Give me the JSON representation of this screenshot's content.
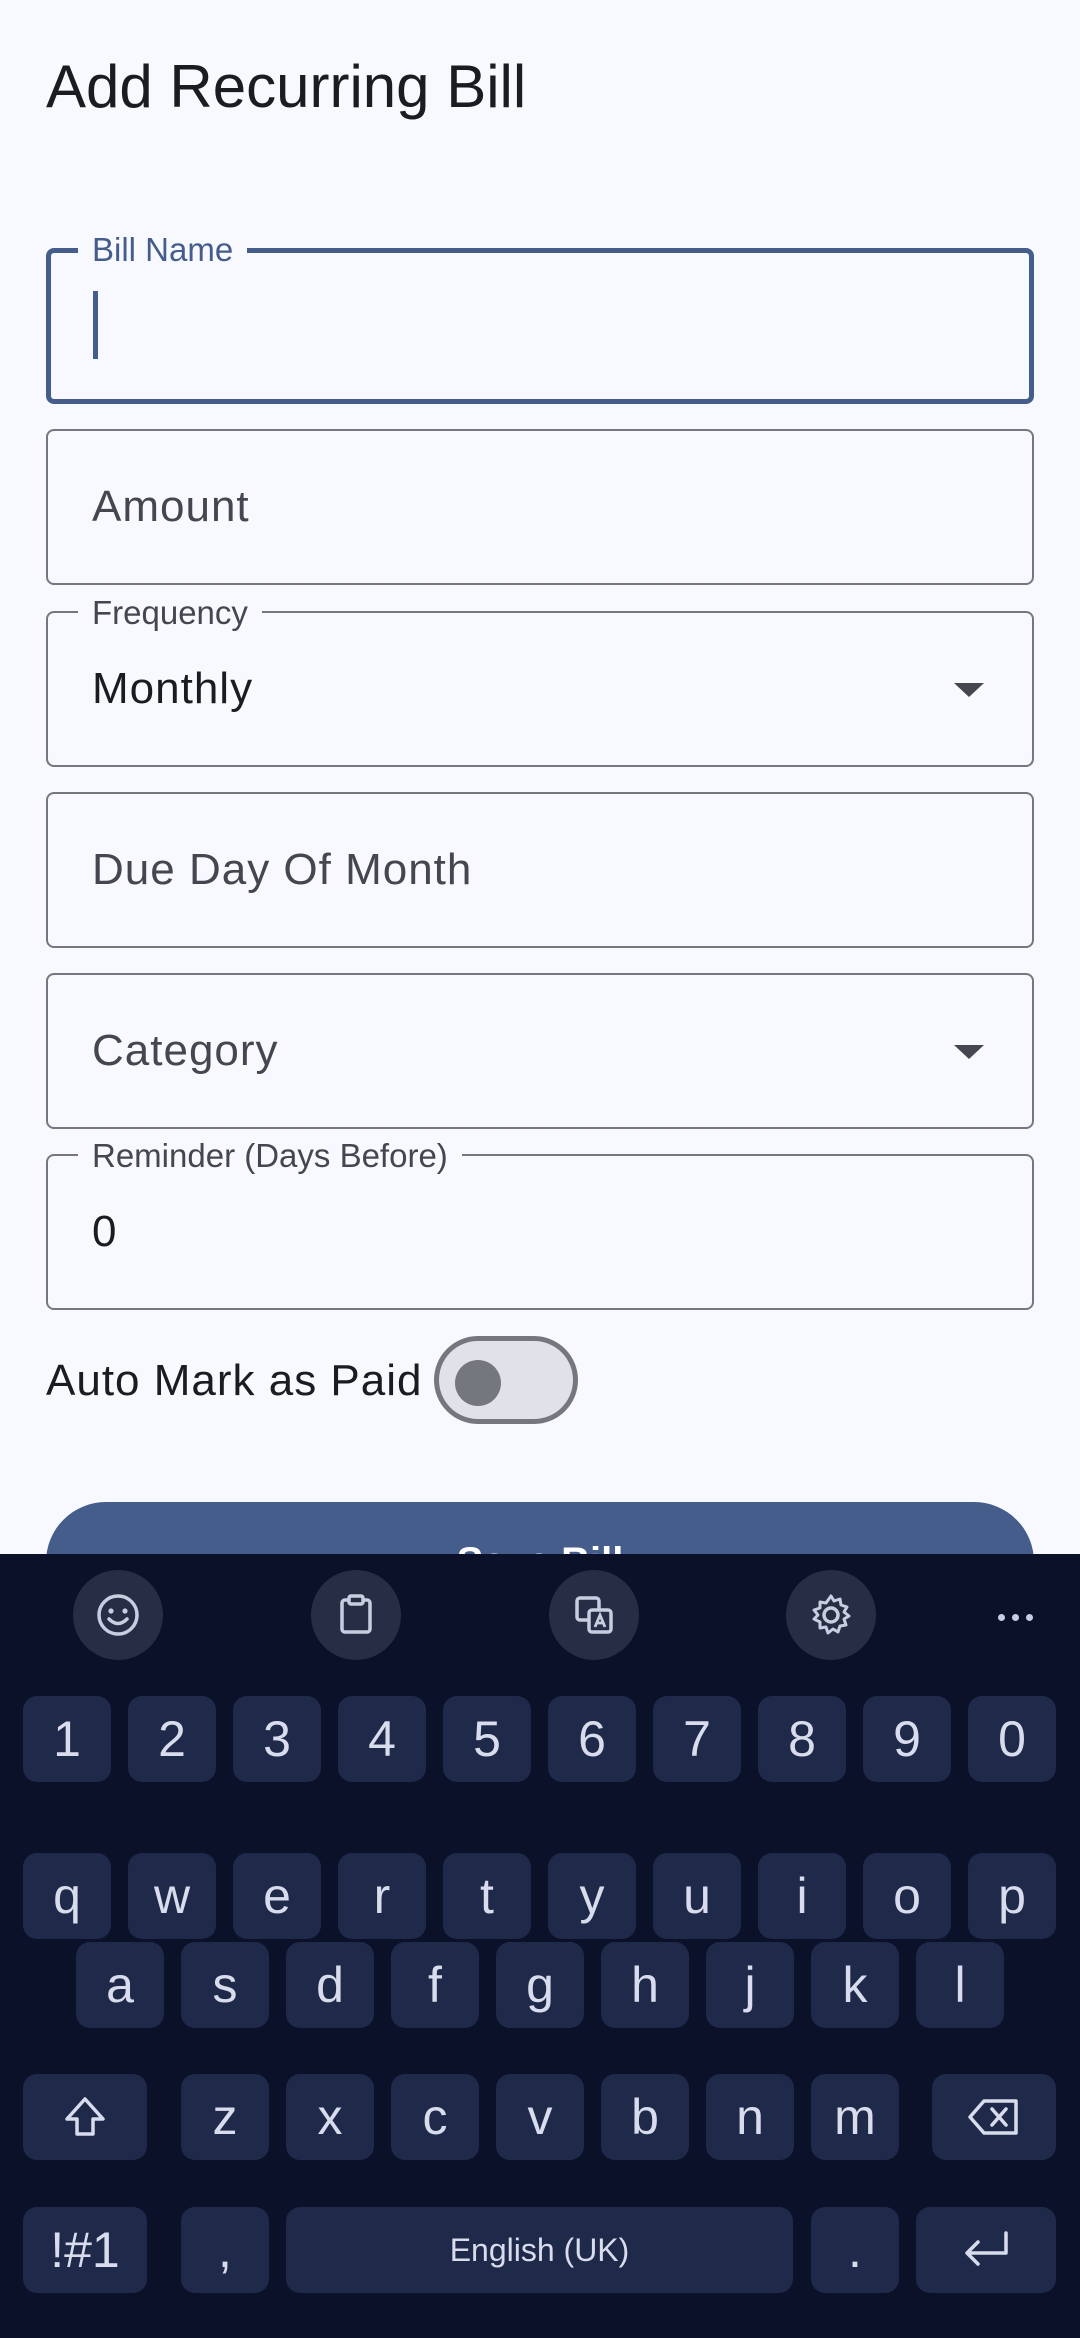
{
  "page": {
    "title": "Add Recurring Bill"
  },
  "form": {
    "bill_name": {
      "label": "Bill Name",
      "value": ""
    },
    "amount": {
      "placeholder": "Amount"
    },
    "frequency": {
      "label": "Frequency",
      "value": "Monthly"
    },
    "due_day": {
      "placeholder": "Due Day Of Month"
    },
    "category": {
      "placeholder": "Category"
    },
    "reminder": {
      "label": "Reminder (Days Before)",
      "value": "0"
    },
    "auto_mark_paid": {
      "label": "Auto Mark as Paid",
      "checked": false
    },
    "save_label": "Save Bill"
  },
  "keyboard": {
    "toolbar": [
      "emoji-icon",
      "clipboard-icon",
      "translate-icon",
      "settings-icon",
      "more-icon"
    ],
    "number_row": [
      "1",
      "2",
      "3",
      "4",
      "5",
      "6",
      "7",
      "8",
      "9",
      "0"
    ],
    "row1": [
      "q",
      "w",
      "e",
      "r",
      "t",
      "y",
      "u",
      "i",
      "o",
      "p"
    ],
    "row2": [
      "a",
      "s",
      "d",
      "f",
      "g",
      "h",
      "j",
      "k",
      "l"
    ],
    "row3": [
      "z",
      "x",
      "c",
      "v",
      "b",
      "n",
      "m"
    ],
    "symbols_label": "!#1",
    "comma": ",",
    "space_label": "English (UK)",
    "period": "."
  },
  "colors": {
    "accent": "#455d8b",
    "keyboard_bg": "#0b1128",
    "key_bg": "#1f2a4a"
  }
}
